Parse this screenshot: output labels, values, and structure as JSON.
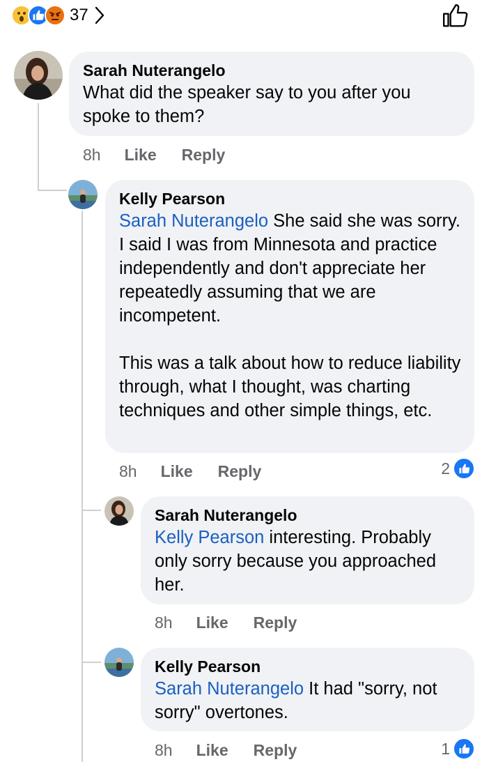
{
  "post_reactions": {
    "emojis": [
      "wow-emoji-icon",
      "like-emoji-icon",
      "angry-emoji-icon"
    ],
    "count": "37"
  },
  "colors": {
    "mention": "#1b5fc1",
    "bubble": "#f0f2f5",
    "like_blue": "#1877f2",
    "meta": "#65676b"
  },
  "comments": [
    {
      "author": "Sarah Nuterangelo",
      "mention": "",
      "text": "What did the speaker say to you after you spoke to them?",
      "time": "8h",
      "like": "Like",
      "reply": "Reply",
      "reaction_count": ""
    },
    {
      "author": "Kelly Pearson",
      "mention": "Sarah Nuterangelo",
      "text": " She said she was sorry. I said I was from Minnesota and practice independently and don't appreciate her repeatedly assuming that we are incompetent.",
      "text2": "This was a talk about how to reduce liability through, what I thought, was charting techniques and other simple things, etc.",
      "time": "8h",
      "like": "Like",
      "reply": "Reply",
      "reaction_count": "2"
    },
    {
      "author": "Sarah Nuterangelo",
      "mention": "Kelly Pearson",
      "text": " interesting. Probably only sorry because you approached her.",
      "time": "8h",
      "like": "Like",
      "reply": "Reply",
      "reaction_count": ""
    },
    {
      "author": "Kelly Pearson",
      "mention": "Sarah Nuterangelo",
      "text": " It had \"sorry, not sorry\" overtones.",
      "time": "8h",
      "like": "Like",
      "reply": "Reply",
      "reaction_count": "1"
    }
  ]
}
